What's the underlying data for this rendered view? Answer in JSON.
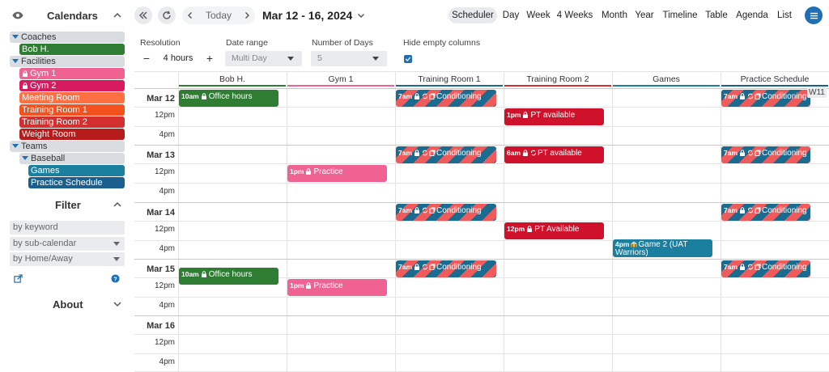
{
  "sidebar": {
    "calendars_title": "Calendars",
    "tree": [
      {
        "label": "Coaches",
        "type": "group",
        "level": 0
      },
      {
        "label": "Bob H.",
        "type": "leaf",
        "color": "#2e7d32",
        "level": 1,
        "lock": false
      },
      {
        "label": "Facilities",
        "type": "group",
        "level": 0
      },
      {
        "label": "Gym 1",
        "type": "leaf",
        "color": "#f06292",
        "level": 1,
        "lock": true
      },
      {
        "label": "Gym 2",
        "type": "leaf",
        "color": "#d81b60",
        "level": 1,
        "lock": true
      },
      {
        "label": "Meeting Room",
        "type": "leaf",
        "color": "#ff7043",
        "level": 1,
        "lock": false
      },
      {
        "label": "Training Room 1",
        "type": "leaf",
        "color": "#f4511e",
        "level": 1,
        "lock": false
      },
      {
        "label": "Training Room 2",
        "type": "leaf",
        "color": "#d32f2f",
        "level": 1,
        "lock": false
      },
      {
        "label": "Weight Room",
        "type": "leaf",
        "color": "#b71c1c",
        "level": 1,
        "lock": false
      },
      {
        "label": "Teams",
        "type": "group",
        "level": 0
      },
      {
        "label": "Baseball",
        "type": "group",
        "level": 1
      },
      {
        "label": "Games",
        "type": "leaf",
        "color": "#1b7fa0",
        "level": 2,
        "lock": false
      },
      {
        "label": "Practice Schedule",
        "type": "leaf",
        "color": "#1b5f8f",
        "level": 2,
        "lock": false
      }
    ],
    "filter_title": "Filter",
    "filter_keyword": "by keyword",
    "filter_subcalendar": "by sub-calendar",
    "filter_homeaway": "by Home/Away",
    "about_title": "About"
  },
  "toolbar": {
    "today_label": "Today",
    "date_range": "Mar 12 - 16, 2024",
    "views": [
      "Scheduler",
      "Day",
      "Week",
      "4 Weeks",
      "Month",
      "Year",
      "Timeline",
      "Table",
      "Agenda",
      "List"
    ],
    "active_view": "Scheduler"
  },
  "options": {
    "resolution_label": "Resolution",
    "resolution_value": "4 hours",
    "date_range_label": "Date range",
    "date_range_value": "Multi Day",
    "num_days_label": "Number of Days",
    "num_days_value": "5",
    "hide_empty_label": "Hide empty columns",
    "hide_empty_checked": true
  },
  "scheduler": {
    "columns": [
      {
        "name": "Bob H.",
        "color": "#2e7d32"
      },
      {
        "name": "Gym 1",
        "color": "#f06292"
      },
      {
        "name": "Training Room 1",
        "color": "#1b6a8f"
      },
      {
        "name": "Training Room 2",
        "color": "#d32f2f"
      },
      {
        "name": "Games",
        "color": "#1b7fa0"
      },
      {
        "name": "Practice Schedule",
        "color": "#1b5f8f"
      }
    ],
    "days": [
      {
        "label": "Mar 12",
        "slots": [
          "12pm",
          "4pm"
        ]
      },
      {
        "label": "Mar 13",
        "slots": [
          "12pm",
          "4pm"
        ]
      },
      {
        "label": "Mar 14",
        "slots": [
          "12pm",
          "4pm"
        ]
      },
      {
        "label": "Mar 15",
        "slots": [
          "12pm",
          "4pm"
        ]
      },
      {
        "label": "Mar 16",
        "slots": [
          "12pm",
          "4pm"
        ]
      }
    ],
    "week_badge": "W11",
    "events": [
      {
        "col": 0,
        "day": 0,
        "slot": 0,
        "time": "10am",
        "title": "Office hours",
        "color": "#2e7d32",
        "lock": true,
        "style": "solid"
      },
      {
        "col": 2,
        "day": 0,
        "slot": 0,
        "time": "7am",
        "title": "Conditioning",
        "style": "striped",
        "lock": true,
        "repeat": true
      },
      {
        "col": 3,
        "day": 0,
        "slot": 1,
        "time": "1pm",
        "title": "PT available",
        "color": "#d0112b",
        "lock": true,
        "style": "solid"
      },
      {
        "col": 5,
        "day": 0,
        "slot": 0,
        "time": "7am",
        "title": "Conditioning",
        "style": "striped",
        "lock": true,
        "repeat": true
      },
      {
        "col": 2,
        "day": 1,
        "slot": 0,
        "time": "7am",
        "title": "Conditioning",
        "style": "striped",
        "lock": true,
        "repeat": true
      },
      {
        "col": 3,
        "day": 1,
        "slot": 0,
        "time": "6am",
        "title": "PT available",
        "color": "#d0112b",
        "lock": true,
        "repeat": true,
        "style": "solid"
      },
      {
        "col": 5,
        "day": 1,
        "slot": 0,
        "time": "7am",
        "title": "Conditioning",
        "style": "striped",
        "lock": true,
        "repeat": true
      },
      {
        "col": 1,
        "day": 1,
        "slot": 1,
        "time": "1pm",
        "title": "Practice",
        "color": "#f06292",
        "lock": true,
        "style": "solid"
      },
      {
        "col": 2,
        "day": 2,
        "slot": 0,
        "time": "7am",
        "title": "Conditioning",
        "style": "striped",
        "lock": true,
        "repeat": true
      },
      {
        "col": 5,
        "day": 2,
        "slot": 0,
        "time": "7am",
        "title": "Conditioning",
        "style": "striped",
        "lock": true,
        "repeat": true
      },
      {
        "col": 3,
        "day": 2,
        "slot": 1,
        "time": "12pm",
        "title": "PT Available",
        "color": "#d0112b",
        "lock": true,
        "style": "solid"
      },
      {
        "col": 4,
        "day": 2,
        "slot": 2,
        "time": "4pm",
        "title": "Game 2 (UAT Warriors)",
        "color": "#1b7fa0",
        "style": "tall",
        "stadium": true
      },
      {
        "col": 2,
        "day": 3,
        "slot": 0,
        "time": "7am",
        "title": "Conditioning",
        "style": "striped",
        "lock": true,
        "repeat": true
      },
      {
        "col": 5,
        "day": 3,
        "slot": 0,
        "time": "7am",
        "title": "Conditioning",
        "style": "striped",
        "lock": true,
        "repeat": true
      },
      {
        "col": 0,
        "day": 3,
        "slot": 0,
        "time": "10am",
        "title": "Office hours",
        "color": "#2e7d32",
        "lock": true,
        "style": "solid",
        "nudge": 1
      },
      {
        "col": 1,
        "day": 3,
        "slot": 1,
        "time": "1pm",
        "title": "Practice",
        "color": "#f06292",
        "lock": true,
        "style": "solid"
      }
    ]
  }
}
